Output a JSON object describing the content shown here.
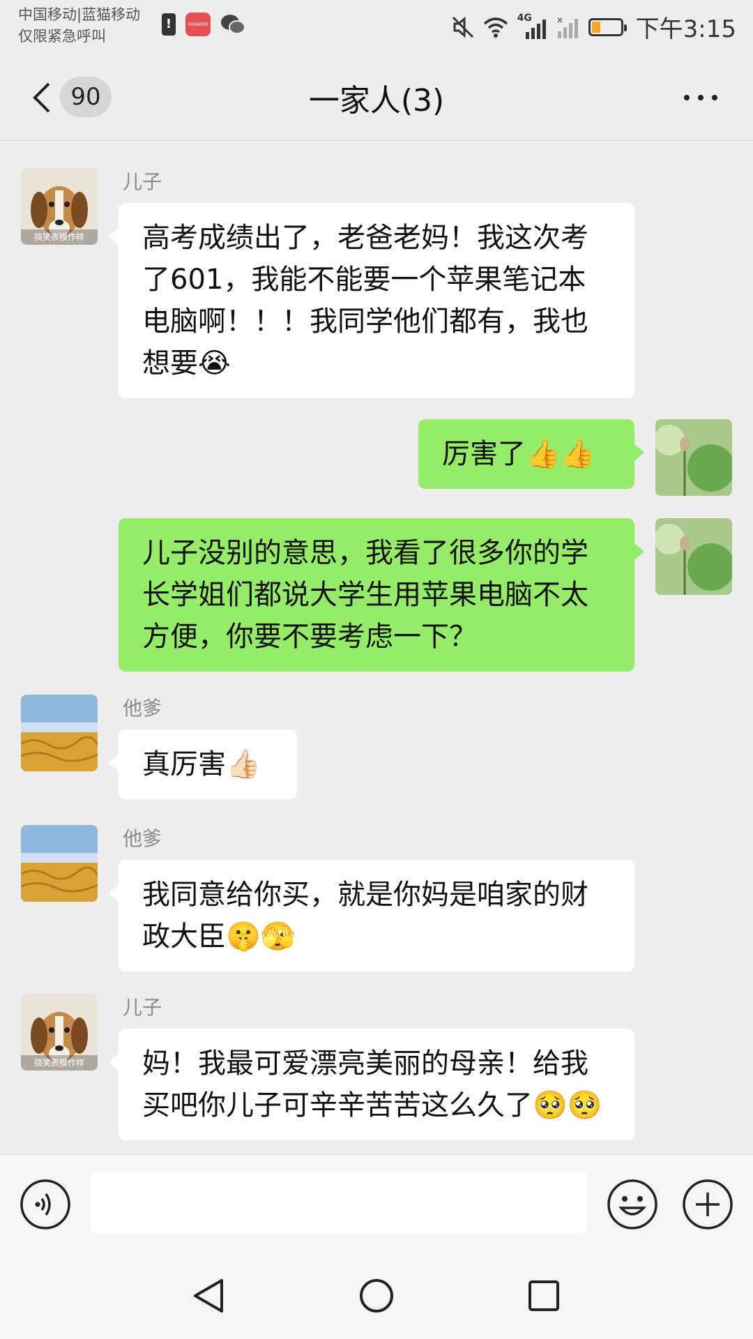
{
  "status_bar": {
    "carrier_line1": "中国移动|蓝猫移动",
    "carrier_line2": "仅限紧急呼叫",
    "network_label": "4G",
    "time": "下午3:15",
    "huawei_label": "HUAWEI"
  },
  "header": {
    "back_unread_count": "90",
    "title": "一家人(3)"
  },
  "messages": [
    {
      "side": "left",
      "sender": "儿子",
      "avatar": "beagle-dog-avatar",
      "avatar_caption": "搞笑表模作样",
      "text": "高考成绩出了，老爸老妈！我这次考了601，我能不能要一个苹果笔记本电脑啊！！！我同学他们都有，我也想要😭"
    },
    {
      "side": "right",
      "sender": "",
      "avatar": "lotus-leaf-avatar",
      "text": "厉害了👍👍"
    },
    {
      "side": "right",
      "sender": "",
      "avatar": "lotus-leaf-avatar",
      "text": "儿子没别的意思，我看了很多你的学长学姐们都说大学生用苹果电脑不太方便，你要不要考虑一下？"
    },
    {
      "side": "left",
      "sender": "他爹",
      "avatar": "wheat-field-avatar",
      "text": "真厉害👍🏻"
    },
    {
      "side": "left",
      "sender": "他爹",
      "avatar": "wheat-field-avatar",
      "text": "我同意给你买，就是你妈是咱家的财政大臣🤫🫣"
    },
    {
      "side": "left",
      "sender": "儿子",
      "avatar": "beagle-dog-avatar",
      "avatar_caption": "搞笑表模作样",
      "text": "妈！我最可爱漂亮美丽的母亲！给我买吧你儿子可辛辛苦苦这么久了🥺🥺"
    }
  ],
  "input_bar": {
    "value": "",
    "placeholder": ""
  },
  "icons": {
    "voice": "voice-input-icon",
    "emoji": "emoji-icon",
    "plus": "plus-icon"
  },
  "colors": {
    "background": "#ededed",
    "sent_bubble": "#95ec69",
    "received_bubble": "#ffffff",
    "sender_name": "#8a8a8a"
  }
}
